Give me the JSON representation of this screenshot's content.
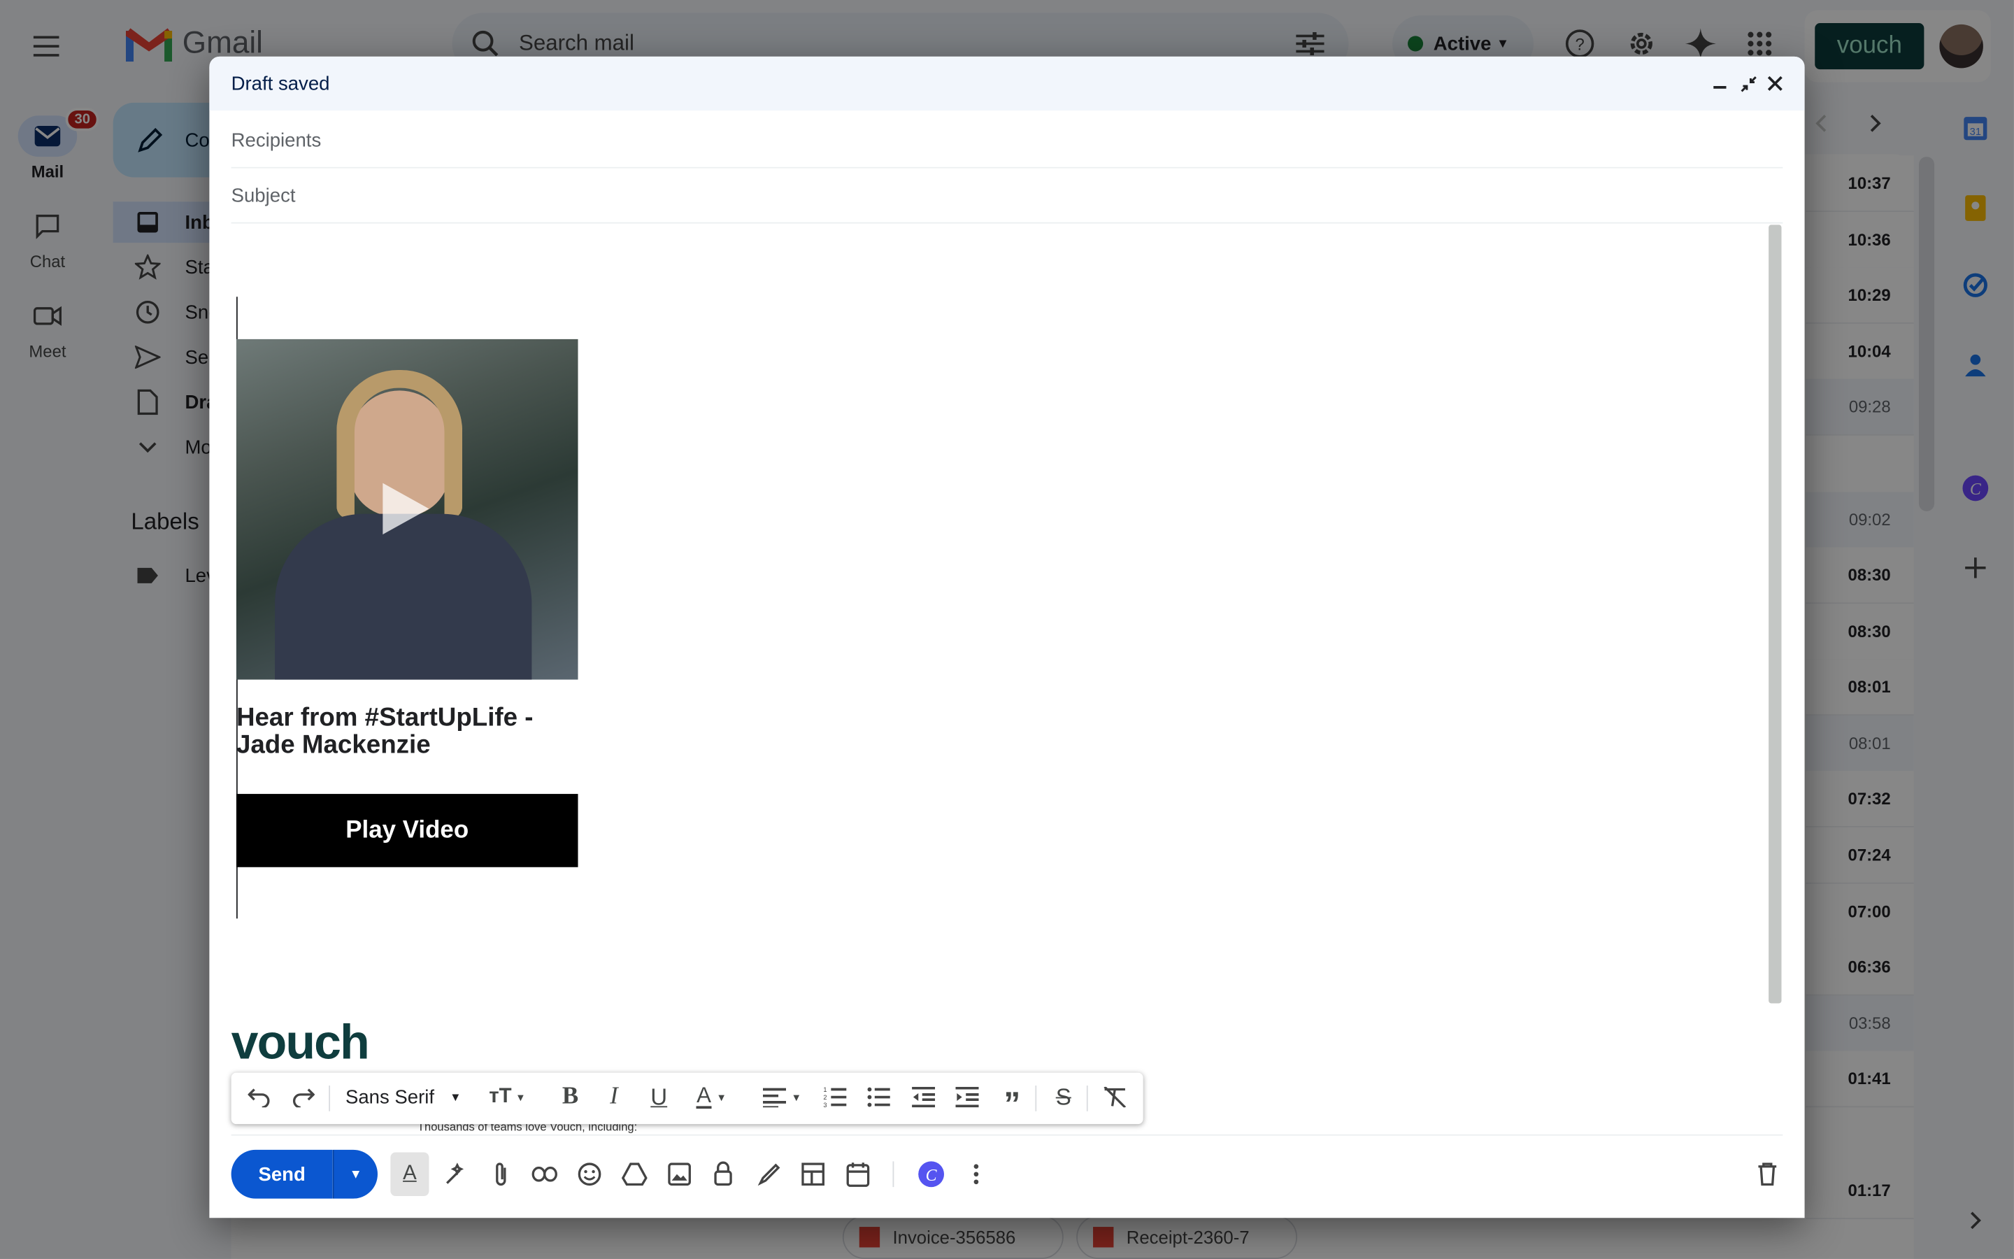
{
  "app": {
    "name": "Gmail",
    "brand_color": "#ea4335"
  },
  "header": {
    "search_placeholder": "Search mail",
    "status_label": "Active",
    "account_label": "vouch"
  },
  "rail": {
    "mail_badge": "30",
    "items": [
      {
        "label": "Mail",
        "icon": "mail-icon"
      },
      {
        "label": "Chat",
        "icon": "chat-icon"
      },
      {
        "label": "Meet",
        "icon": "meet-icon"
      }
    ]
  },
  "sidebar": {
    "compose_label": "Co",
    "items": [
      {
        "label": "Inb",
        "icon": "inbox-icon"
      },
      {
        "label": "Sta",
        "icon": "star-icon"
      },
      {
        "label": "Sno",
        "icon": "clock-icon"
      },
      {
        "label": "Sen",
        "icon": "send-icon"
      },
      {
        "label": "Dra",
        "icon": "draft-icon"
      },
      {
        "label": "Mo",
        "icon": "chevron-down-icon"
      }
    ],
    "labels_heading": "Labels",
    "labels": [
      {
        "label": "Lev",
        "icon": "label-icon"
      }
    ]
  },
  "email_list": {
    "times": [
      "10:37",
      "10:36",
      "10:29",
      "10:04",
      "09:28",
      "09:02",
      "08:30",
      "08:30",
      "08:01",
      "08:01",
      "07:32",
      "07:24",
      "07:00",
      "06:36",
      "03:58",
      "01:41",
      "01:17"
    ],
    "attachments": [
      "Invoice-356586",
      "Receipt-2360-7"
    ]
  },
  "compose": {
    "title": "Draft saved",
    "recipients_placeholder": "Recipients",
    "subject_placeholder": "Subject",
    "body": {
      "video_heading": "Hear from #StartUpLife - Jade Mackenzie",
      "play_button": "Play Video",
      "brand_logo": "vouch",
      "tagline": "Thousands of teams love Vouch, including:"
    },
    "format_bar": {
      "font_family": "Sans Serif"
    },
    "send_label": "Send"
  }
}
